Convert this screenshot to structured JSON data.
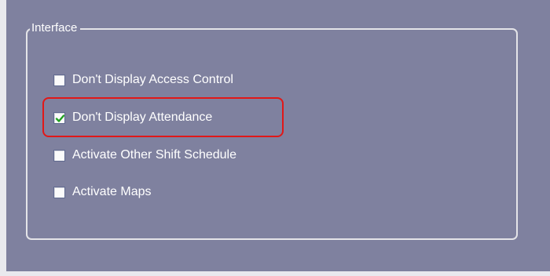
{
  "interface": {
    "legend": "Interface",
    "options": [
      {
        "label": "Don't Display Access Control",
        "checked": false
      },
      {
        "label": "Don't Display Attendance",
        "checked": true
      },
      {
        "label": "Activate Other Shift Schedule",
        "checked": false
      },
      {
        "label": "Activate Maps",
        "checked": false
      }
    ]
  },
  "colors": {
    "panel_background": "#7f819f",
    "highlight": "#e11818",
    "checkmark": "#21a121"
  }
}
